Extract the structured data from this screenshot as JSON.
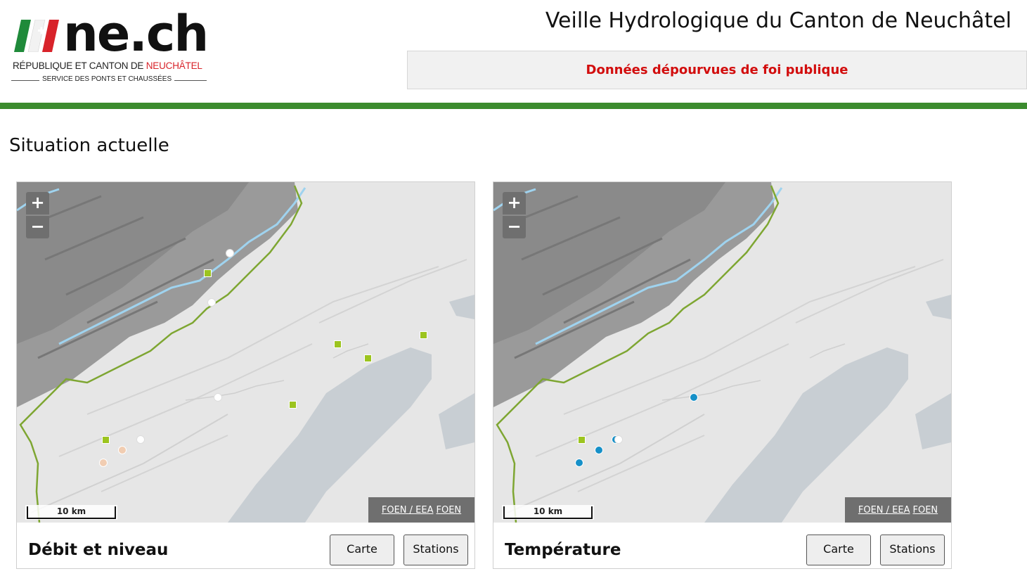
{
  "header": {
    "brand": "ne.ch",
    "republic_prefix": "RÉPUBLIQUE ET CANTON DE ",
    "republic_highlight": "NEUCHÂTEL",
    "service": "SERVICE DES PONTS ET CHAUSSÉES",
    "site_title": "Veille Hydrologique du Canton de Neuchâtel",
    "disclaimer": "Données dépourvues de foi publique"
  },
  "colors": {
    "accent_green": "#3b8b2e",
    "disclaimer_red": "#d20d0d",
    "marker_green": "#9cc41f",
    "marker_blue": "#1690c8",
    "marker_peach": "#f1cdb2"
  },
  "main": {
    "section_title": "Situation actuelle",
    "cards": [
      {
        "title": "Débit et niveau",
        "carte_label": "Carte",
        "stations_label": "Stations",
        "zoom_in": "+",
        "zoom_out": "−",
        "scale_label": "10 km",
        "attribution_1": "FOEN / EEA",
        "attribution_2": "FOEN",
        "markers": [
          {
            "kind": "sq",
            "color": "green"
          },
          {
            "kind": "dot",
            "color": "white"
          },
          {
            "kind": "dot",
            "color": "white"
          },
          {
            "kind": "sq",
            "color": "green"
          },
          {
            "kind": "sq",
            "color": "green"
          },
          {
            "kind": "sq",
            "color": "green"
          },
          {
            "kind": "dot",
            "color": "white"
          },
          {
            "kind": "sq",
            "color": "green"
          },
          {
            "kind": "sq",
            "color": "green"
          },
          {
            "kind": "dot",
            "color": "white"
          },
          {
            "kind": "dot",
            "color": "peach"
          },
          {
            "kind": "dot",
            "color": "peach"
          }
        ]
      },
      {
        "title": "Température",
        "carte_label": "Carte",
        "stations_label": "Stations",
        "zoom_in": "+",
        "zoom_out": "−",
        "scale_label": "10 km",
        "attribution_1": "FOEN / EEA",
        "attribution_2": "FOEN",
        "markers": [
          {
            "kind": "dot",
            "color": "blue"
          },
          {
            "kind": "sq",
            "color": "green"
          },
          {
            "kind": "dot",
            "color": "blue"
          },
          {
            "kind": "dot",
            "color": "white"
          },
          {
            "kind": "dot",
            "color": "blue"
          },
          {
            "kind": "dot",
            "color": "blue"
          }
        ]
      }
    ]
  }
}
